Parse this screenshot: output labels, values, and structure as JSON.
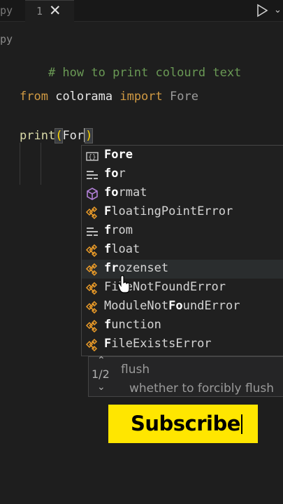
{
  "tabbar": {
    "left_tab_fragment": "py",
    "active_tab_number": "1",
    "close_symbol": "✕",
    "run_chevron": "⌄"
  },
  "breadcrumb": {
    "text": "py"
  },
  "editor": {
    "line_comment": "# how to print colourd text",
    "line_import": {
      "from": "from",
      "module": "colorama",
      "import": "import",
      "name": "Fore"
    },
    "line_print": {
      "fn": "print",
      "open": "(",
      "typed": "For",
      "close": ")"
    }
  },
  "suggestions": {
    "items": [
      {
        "pre": "",
        "bold": "Fore",
        "post": "",
        "icon": "variable-icon",
        "color": "#c0c0c0"
      },
      {
        "pre": "",
        "bold": "fo",
        "post": "r",
        "icon": "keyword-icon",
        "color": "#bdbdbd"
      },
      {
        "pre": "",
        "bold": "fo",
        "post": "rmat",
        "icon": "method-icon",
        "color": "#b180d7"
      },
      {
        "pre": "",
        "bold": "F",
        "post": "loatingPointError",
        "bold2": "",
        "icon": "class-icon",
        "color": "#ee9d28"
      },
      {
        "pre": "",
        "bold": "f",
        "post": "rom",
        "icon": "keyword-icon",
        "color": "#bdbdbd"
      },
      {
        "pre": "",
        "bold": "f",
        "post": "loat",
        "icon": "class-icon",
        "color": "#ee9d28"
      },
      {
        "pre": "",
        "bold": "fr",
        "post": "ozenset",
        "icon": "class-icon",
        "color": "#ee9d28"
      },
      {
        "pre": "Fi",
        "bold": "",
        "post": "leNotFoundError",
        "icon": "class-icon",
        "color": "#ee9d28"
      },
      {
        "pre": "ModuleNot",
        "bold": "Fo",
        "post": "undError",
        "icon": "class-icon",
        "color": "#ee9d28"
      },
      {
        "pre": "",
        "bold": "f",
        "post": "unction",
        "icon": "class-icon",
        "color": "#ee9d28"
      },
      {
        "pre": "",
        "bold": "F",
        "post": "ileExistsError",
        "icon": "class-icon",
        "color": "#ee9d28"
      }
    ],
    "labels": [
      "Fore",
      "for",
      "format",
      "FloatingPointError",
      "from",
      "float",
      "frozenset",
      "FileNotFoundError",
      "ModuleNotFoundError",
      "function",
      "FileExistsError"
    ]
  },
  "signature": {
    "up": "⌃",
    "count": "1/2",
    "down": "⌄",
    "line1": "flush",
    "line2": "whether to forcibly flush"
  },
  "overlay": {
    "subscribe": "Subscribe",
    "accent": "#ffe600"
  }
}
